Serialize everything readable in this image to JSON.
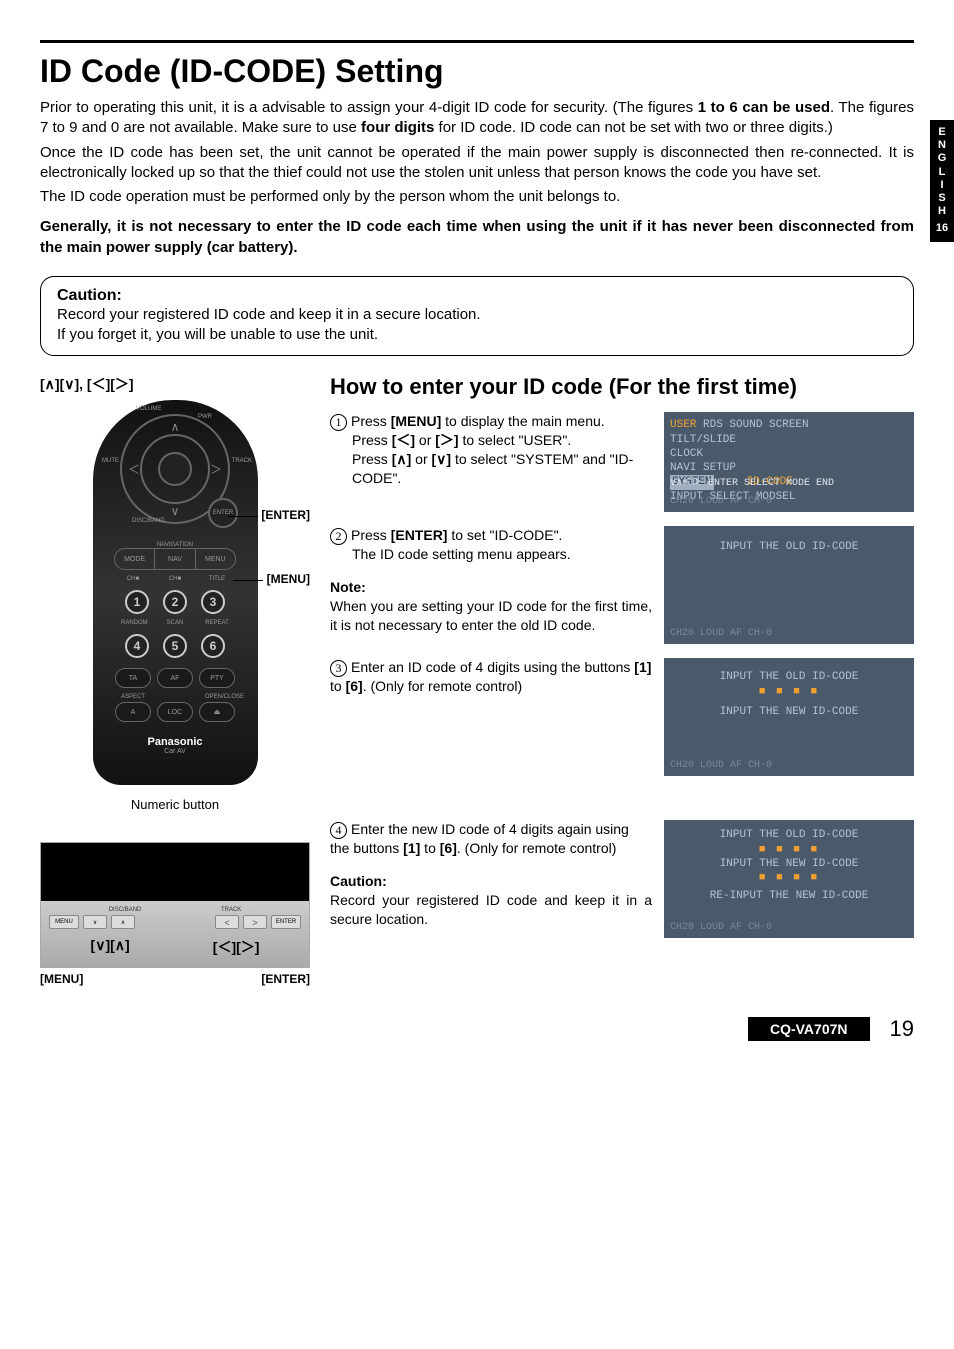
{
  "sideTab": {
    "lang": "ENGLISH",
    "page": "16"
  },
  "title": "ID Code (ID-CODE) Setting",
  "intro": {
    "p1a": "Prior to operating this unit, it is a advisable to assign your 4-digit ID code for security. (The figures ",
    "p1b": "1 to 6 can be used",
    "p1c": ". The figures 7 to 9 and 0 are not available. Make sure to use ",
    "p1d": "four digits",
    "p1e": " for ID code. ID code can not be set with two or three digits.)",
    "p2": "Once the ID code has been set, the unit cannot be operated if the main power supply is disconnected then re-connected. It is electronically locked up so that the thief could not use the stolen unit unless that person knows the code you have set.",
    "p3": "The ID code operation must be performed only by the person whom the unit belongs to.",
    "p4": "Generally, it is not necessary to enter the ID code each time when using the unit if it has never been disconnected from the main power supply (car battery)."
  },
  "cautionTop": {
    "title": "Caution:",
    "l1": "Record your registered ID code and keep it in a secure location.",
    "l2": "If you forget it, you will be unable to use the unit."
  },
  "leftCol": {
    "arrowHeader": "[∧][∨], [＜][＞]",
    "enterLabel": "[ENTER]",
    "menuLabel": "[MENU]",
    "numericCaption": "Numeric button",
    "headArrows1": "[∨][∧]",
    "headArrows2": "[＜][＞]",
    "headMenu": "[MENU]",
    "headEnter": "[ENTER]",
    "remote": {
      "navi": "NAVIGATION",
      "mode": "MODE",
      "navBtn": "NAV",
      "menuBtn": "MENU",
      "ch1": "CH■",
      "ch2": "CH■",
      "title": "TITLE",
      "random": "RANDOM",
      "scan": "SCAN",
      "repeat": "REPEAT",
      "ta": "TA",
      "af": "AF",
      "pty": "PTY",
      "aspect": "ASPECT",
      "openclose": "OPEN/CLOSE",
      "a": "A",
      "loc": "LOC",
      "eject": "⏏",
      "brand": "Panasonic",
      "brandSub": "Car AV",
      "enter": "ENTER",
      "pwr": "PWR",
      "mute": "MUTE",
      "track": "TRACK",
      "discband": "DISC/BAND",
      "volume": "VOLUME",
      "n1": "1",
      "n2": "2",
      "n3": "3",
      "n4": "4",
      "n5": "5",
      "n6": "6"
    },
    "headunit": {
      "discband": "DISC/BAND",
      "track": "TRACK",
      "menu": "MENU",
      "enter": "ENTER"
    }
  },
  "howTo": {
    "heading": "How to enter your ID code (For the first time)",
    "step1": {
      "num": "1",
      "a": "Press ",
      "b": "[MENU]",
      "c": " to display the main menu.",
      "d": "Press ",
      "e": "[＜]",
      "f": " or ",
      "g": "[＞]",
      "h": " to select \"USER\".",
      "i": "Press ",
      "j": "[∧]",
      "k": " or ",
      "l": "[∨]",
      "m": " to select \"SYSTEM\" and \"ID-CODE\"."
    },
    "step2": {
      "num": "2",
      "a": "Press ",
      "b": "[ENTER]",
      "c": " to set \"ID-CODE\".",
      "d": "The ID code setting menu appears."
    },
    "note": {
      "title": "Note:",
      "body": "When you are setting your ID code for the first time, it is not necessary to enter the old ID code."
    },
    "step3": {
      "num": "3",
      "a": "Enter an ID code of 4 digits using the buttons ",
      "b": "[1]",
      "c": " to ",
      "d": "[6]",
      "e": ". (Only for remote control)"
    },
    "step4": {
      "num": "4",
      "a": "Enter the new ID code of 4 digits again using the buttons ",
      "b": "[1]",
      "c": " to ",
      "d": "[6]",
      "e": ". (Only for remote control)"
    },
    "caution2": {
      "title": "Caution:",
      "body": "Record your registered ID code and keep it in a secure location."
    }
  },
  "screens": {
    "s1": {
      "l1a": "USER",
      "l1b": " RDS  SOUND  SCREEN",
      "l2": "TILT/SLIDE",
      "l3": "CLOCK",
      "l4": "NAVI SETUP",
      "l5a": "SYSTEM",
      "l5b": "ID-CODE",
      "l6": "INPUT SELECT  MODSEL",
      "nav": "∨∧＜＞ ENTER SELECT  MODE END",
      "status": "CH20 LOUD AF CH-0"
    },
    "s2": {
      "l1": "INPUT THE OLD ID-CODE",
      "status": "CH20 LOUD AF CH-0"
    },
    "s3": {
      "l1": "INPUT THE OLD ID-CODE",
      "boxes": "■ ■ ■ ■",
      "l2": "INPUT THE NEW ID-CODE",
      "status": "CH20 LOUD AF CH-0"
    },
    "s4": {
      "l1": "INPUT THE OLD ID-CODE",
      "b1": "■ ■ ■ ■",
      "l2": "INPUT THE NEW ID-CODE",
      "b2": "■ ■ ■ ■",
      "l3": "RE-INPUT THE NEW ID-CODE",
      "status": "CH20 LOUD AF CH-0"
    }
  },
  "footer": {
    "model": "CQ-VA707N",
    "page": "19"
  }
}
